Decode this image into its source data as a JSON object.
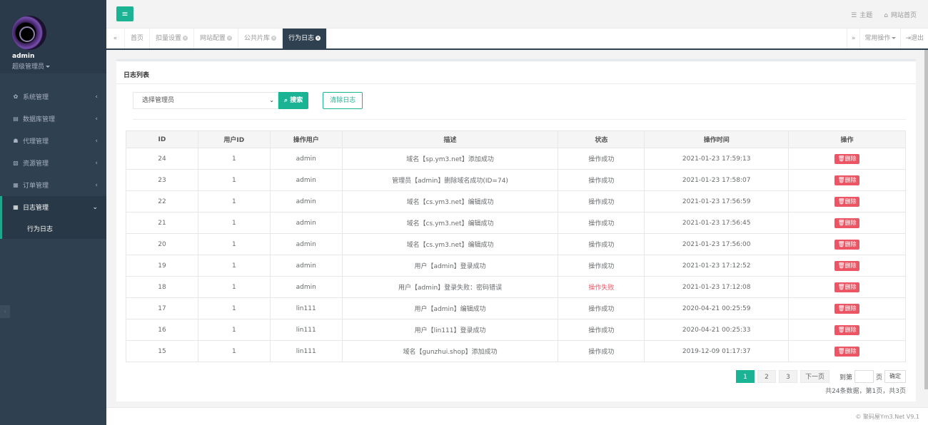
{
  "sidebar": {
    "user": {
      "name": "admin",
      "role": "超级管理员"
    },
    "menu": [
      {
        "icon": "✿",
        "label": "系统管理"
      },
      {
        "icon": "▤",
        "label": "数据库管理"
      },
      {
        "icon": "☗",
        "label": "代理管理"
      },
      {
        "icon": "▧",
        "label": "资源管理"
      },
      {
        "icon": "▦",
        "label": "订单管理"
      },
      {
        "icon": "▦",
        "label": "日志管理"
      }
    ],
    "submenu": {
      "label": "行为日志"
    }
  },
  "header": {
    "menu_icon": "≡",
    "theme": "主题",
    "home": "网站首页"
  },
  "tabs": {
    "items": [
      "首页",
      "扣量设置",
      "网站配置",
      "公共片库",
      "行为日志"
    ],
    "common_ops": "常用操作",
    "logout": "退出"
  },
  "panel": {
    "title": "日志列表",
    "select_placeholder": "选择管理员",
    "search": "搜索",
    "clear": "清除日志"
  },
  "table": {
    "headers": [
      "ID",
      "用户ID",
      "操作用户",
      "描述",
      "状态",
      "操作时间",
      "操作"
    ],
    "delete_label": "删除",
    "rows": [
      {
        "id": "24",
        "uid": "1",
        "user": "admin",
        "desc": "域名【sp.ym3.net】添加成功",
        "status": "操作成功",
        "time": "2021-01-23 17:59:13"
      },
      {
        "id": "23",
        "uid": "1",
        "user": "admin",
        "desc": "管理员【admin】删除域名成功(ID=74)",
        "status": "操作成功",
        "time": "2021-01-23 17:58:07"
      },
      {
        "id": "22",
        "uid": "1",
        "user": "admin",
        "desc": "域名【cs.ym3.net】编辑成功",
        "status": "操作成功",
        "time": "2021-01-23 17:56:59"
      },
      {
        "id": "21",
        "uid": "1",
        "user": "admin",
        "desc": "域名【cs.ym3.net】编辑成功",
        "status": "操作成功",
        "time": "2021-01-23 17:56:45"
      },
      {
        "id": "20",
        "uid": "1",
        "user": "admin",
        "desc": "域名【cs.ym3.net】编辑成功",
        "status": "操作成功",
        "time": "2021-01-23 17:56:00"
      },
      {
        "id": "19",
        "uid": "1",
        "user": "admin",
        "desc": "用户【admin】登录成功",
        "status": "操作成功",
        "time": "2021-01-23 17:12:52"
      },
      {
        "id": "18",
        "uid": "1",
        "user": "admin",
        "desc": "用户【admin】登录失败：密码错误",
        "status": "操作失败",
        "time": "2021-01-23 17:12:08"
      },
      {
        "id": "17",
        "uid": "1",
        "user": "lin111",
        "desc": "用户【admin】编辑成功",
        "status": "操作成功",
        "time": "2020-04-21 00:25:59"
      },
      {
        "id": "16",
        "uid": "1",
        "user": "lin111",
        "desc": "用户【lin111】登录成功",
        "status": "操作成功",
        "time": "2020-04-21 00:25:33"
      },
      {
        "id": "15",
        "uid": "1",
        "user": "lin111",
        "desc": "域名【gunzhui.shop】添加成功",
        "status": "操作成功",
        "time": "2019-12-09 01:17:37"
      }
    ]
  },
  "pager": {
    "pages": [
      "1",
      "2",
      "3"
    ],
    "next": "下一页",
    "goto_label": "到第",
    "page_unit": "页",
    "confirm": "确定",
    "summary": "共24条数据，第1页，共3页"
  },
  "footer": {
    "copyright": "© 聚码屋Ym3.Net V9.1"
  },
  "colors": {
    "accent": "#1ab394",
    "sidebar": "#2f4050",
    "danger": "#ed5565"
  }
}
